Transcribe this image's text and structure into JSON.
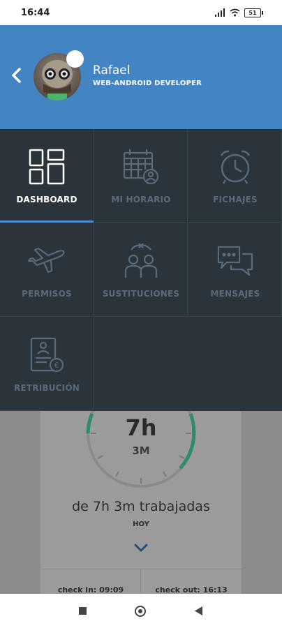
{
  "status_bar": {
    "time": "16:44",
    "battery": "51"
  },
  "profile": {
    "name": "Rafael",
    "role": "WEB-ANDROID DEVELOPER"
  },
  "menu": {
    "items": [
      {
        "label": "DASHBOARD",
        "icon": "dashboard-icon",
        "active": true
      },
      {
        "label": "MI HORARIO",
        "icon": "schedule-icon",
        "active": false
      },
      {
        "label": "FICHAJES",
        "icon": "alarm-clock-icon",
        "active": false
      },
      {
        "label": "PERMISOS",
        "icon": "airplane-icon",
        "active": false
      },
      {
        "label": "SUSTITUCIONES",
        "icon": "substitution-icon",
        "active": false
      },
      {
        "label": "MENSAJES",
        "icon": "messages-icon",
        "active": false
      },
      {
        "label": "RETRIBUCIÓN",
        "icon": "payslip-icon",
        "active": false
      }
    ]
  },
  "dashboard": {
    "hours": "7h",
    "minutes": "3M",
    "worked_text": "de 7h 3m trabajadas",
    "day_label": "HOY",
    "check_in": "check in: 09:09",
    "check_out": "check out: 16:13"
  },
  "colors": {
    "header": "#4384c2",
    "menu_bg": "#2b343a",
    "active_underline": "#4a90d9",
    "progress": "#2e8b6b"
  }
}
